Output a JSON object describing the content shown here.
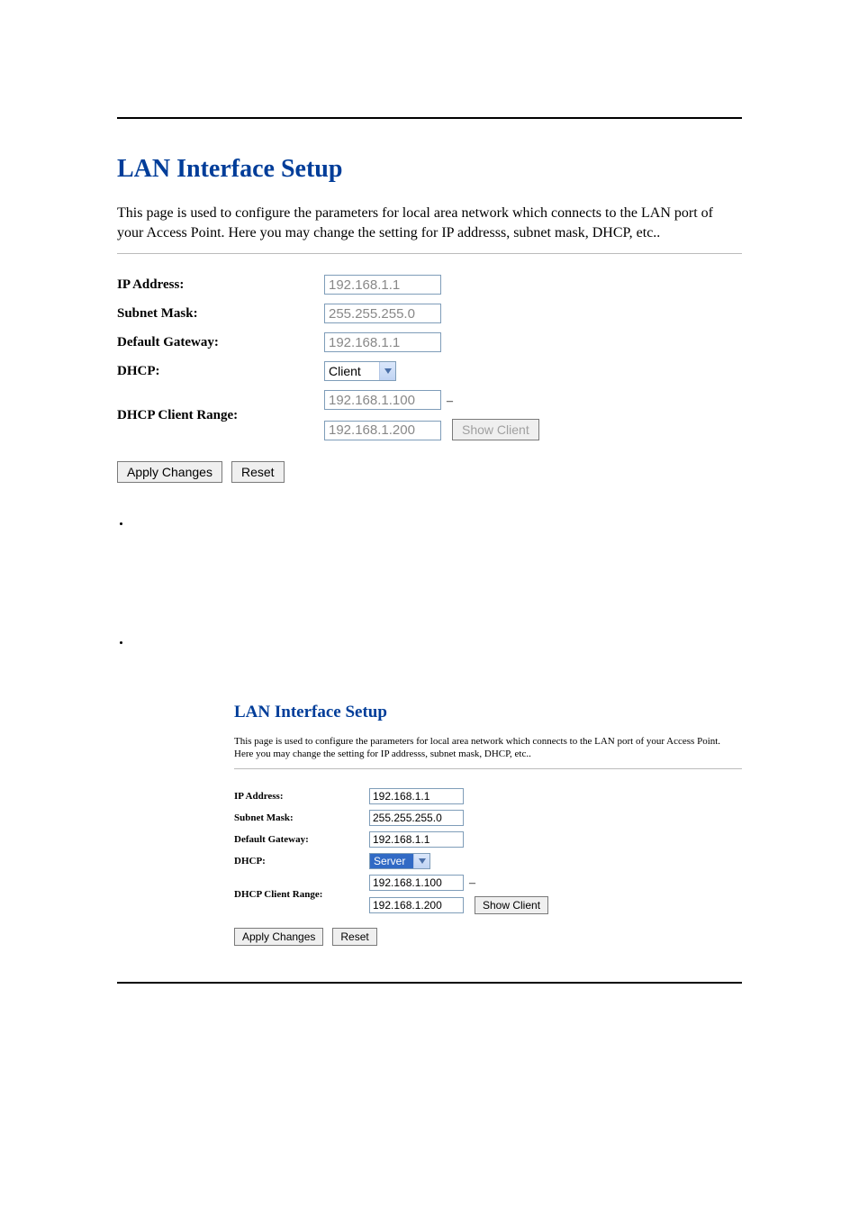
{
  "title": "LAN Interface Setup",
  "description": "This page is used to configure the parameters for local area network which connects to the LAN port of your Access Point. Here you may change the setting for IP addresss, subnet mask, DHCP, etc..",
  "labels": {
    "ip": "IP Address:",
    "subnet": "Subnet Mask:",
    "gateway": "Default Gateway:",
    "dhcp": "DHCP:",
    "range": "DHCP Client Range:"
  },
  "buttons": {
    "apply": "Apply Changes",
    "reset": "Reset",
    "show_client": "Show Client"
  },
  "panel_a": {
    "ip": "192.168.1.1",
    "subnet": "255.255.255.0",
    "gateway": "192.168.1.1",
    "dhcp": "Client",
    "range_start": "192.168.1.100",
    "range_end": "192.168.1.200"
  },
  "panel_b": {
    "ip": "192.168.1.1",
    "subnet": "255.255.255.0",
    "gateway": "192.168.1.1",
    "dhcp": "Server",
    "range_start": "192.168.1.100",
    "range_end": "192.168.1.200"
  },
  "dash": "–"
}
